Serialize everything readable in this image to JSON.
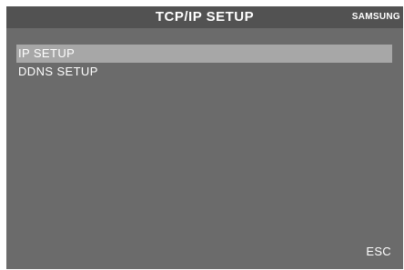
{
  "header": {
    "title": "TCP/IP SETUP",
    "brand": "SAMSUNG"
  },
  "menu": {
    "items": [
      {
        "label": "IP SETUP",
        "selected": true
      },
      {
        "label": "DDNS SETUP",
        "selected": false
      }
    ]
  },
  "footer": {
    "esc_label": "ESC"
  },
  "colors": {
    "background": "#6b6b6b",
    "header": "#525252",
    "selection": "#a7a7a7",
    "text": "#ffffff"
  }
}
